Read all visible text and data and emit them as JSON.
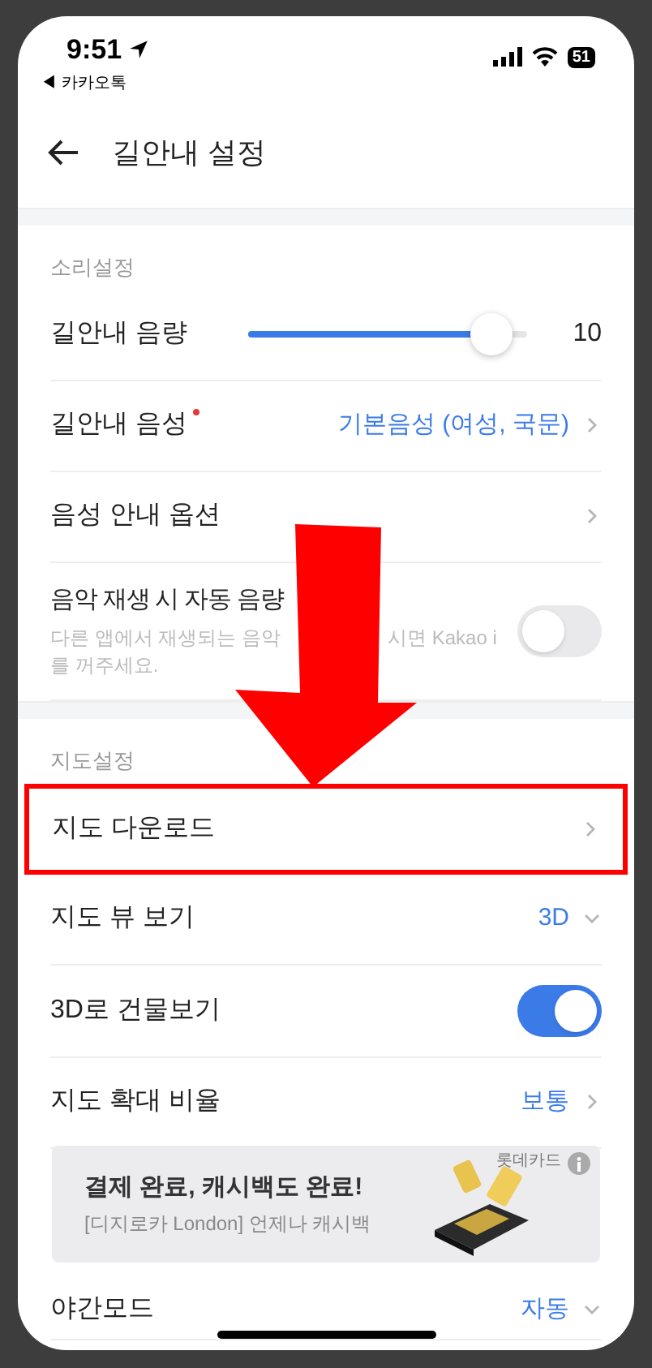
{
  "status_bar": {
    "time": "9:51",
    "back_app": "◀ 카카오톡",
    "battery": "51"
  },
  "header": {
    "title": "길안내 설정"
  },
  "sections": [
    {
      "title": "소리설정",
      "rows": [
        {
          "kind": "slider",
          "label": "길안내 음량",
          "level": 0.87,
          "reading": "10"
        },
        {
          "kind": "link",
          "label": "길안내 음성",
          "new_dot": true,
          "value": "기본음성 (여성, 국문)",
          "highlighted": false
        },
        {
          "kind": "link",
          "label": "음성 안내 옵션",
          "new_dot": false,
          "highlighted": false
        },
        {
          "kind": "toggle",
          "label": "음악 재생 시 자동 음량",
          "description": [
            "다른 앱에서 재생되는 음악",
            "시면 Kakao i",
            "를 꺼주세요."
          ],
          "on": false
        }
      ]
    },
    {
      "title": "지도설정",
      "rows": [
        {
          "kind": "link",
          "label": "지도 다운로드",
          "new_dot": false,
          "highlighted": true
        },
        {
          "kind": "dropdown",
          "label": "지도 뷰 보기",
          "value": "3D"
        },
        {
          "kind": "toggle",
          "label": "3D로 건물보기",
          "on": true
        },
        {
          "kind": "link",
          "label": "지도 확대 비율",
          "new_dot": false,
          "value": "보통",
          "highlighted": false
        },
        {
          "kind": "covered"
        },
        {
          "kind": "dropdown",
          "label": "야간모드",
          "value": "자동"
        }
      ]
    }
  ],
  "ad_banner": {
    "title": "결제 완료, 캐시백도 완료!",
    "subtitle": "[디지로카 London] 언제나 캐시백",
    "brand": "롯데카드"
  }
}
